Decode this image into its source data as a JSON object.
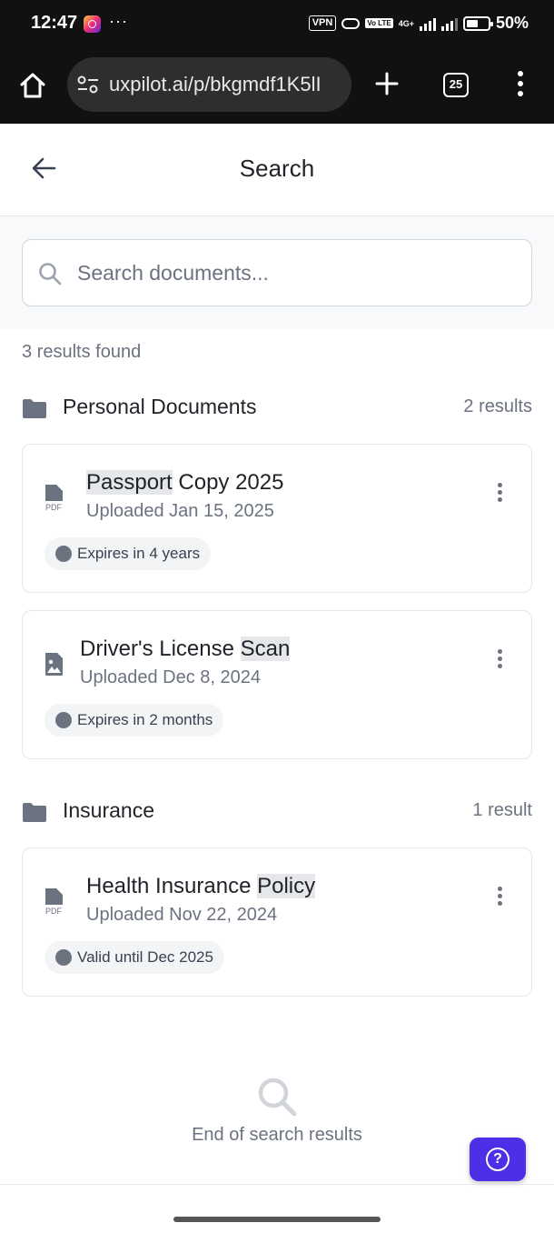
{
  "status_bar": {
    "time": "12:47",
    "dots": "···",
    "vpn": "VPN",
    "volte": "Vo LTE",
    "network": "4G+",
    "battery": "50%"
  },
  "browser": {
    "url": "uxpilot.ai/p/bkgmdf1K5lI",
    "tab_count": "25"
  },
  "header": {
    "title": "Search"
  },
  "search": {
    "placeholder": "Search documents...",
    "value": ""
  },
  "results_summary": "3 results found",
  "sections": [
    {
      "title": "Personal Documents",
      "count": "2 results",
      "documents": [
        {
          "icon": "pdf-file-icon",
          "title_highlight": "Passport",
          "title_rest": " Copy 2025",
          "uploaded": "Uploaded Jan 15, 2025",
          "status": "Expires in 4 years"
        },
        {
          "icon": "image-file-icon",
          "title_rest_before": "Driver's License ",
          "title_highlight": "Scan",
          "uploaded": "Uploaded Dec 8, 2024",
          "status": "Expires in 2 months"
        }
      ]
    },
    {
      "title": "Insurance",
      "count": "1 result",
      "documents": [
        {
          "icon": "pdf-file-icon",
          "title_rest_before": "Health Insurance ",
          "title_highlight": "Policy",
          "uploaded": "Uploaded Nov 22, 2024",
          "status": "Valid until Dec 2025"
        }
      ]
    }
  ],
  "footer": {
    "end_text": "End of search results",
    "help_label": "?"
  },
  "colors": {
    "accent": "#4f2ee8",
    "highlight": "#e5e7eb",
    "muted_text": "#6b7280",
    "status_dot": "#6b7280"
  }
}
